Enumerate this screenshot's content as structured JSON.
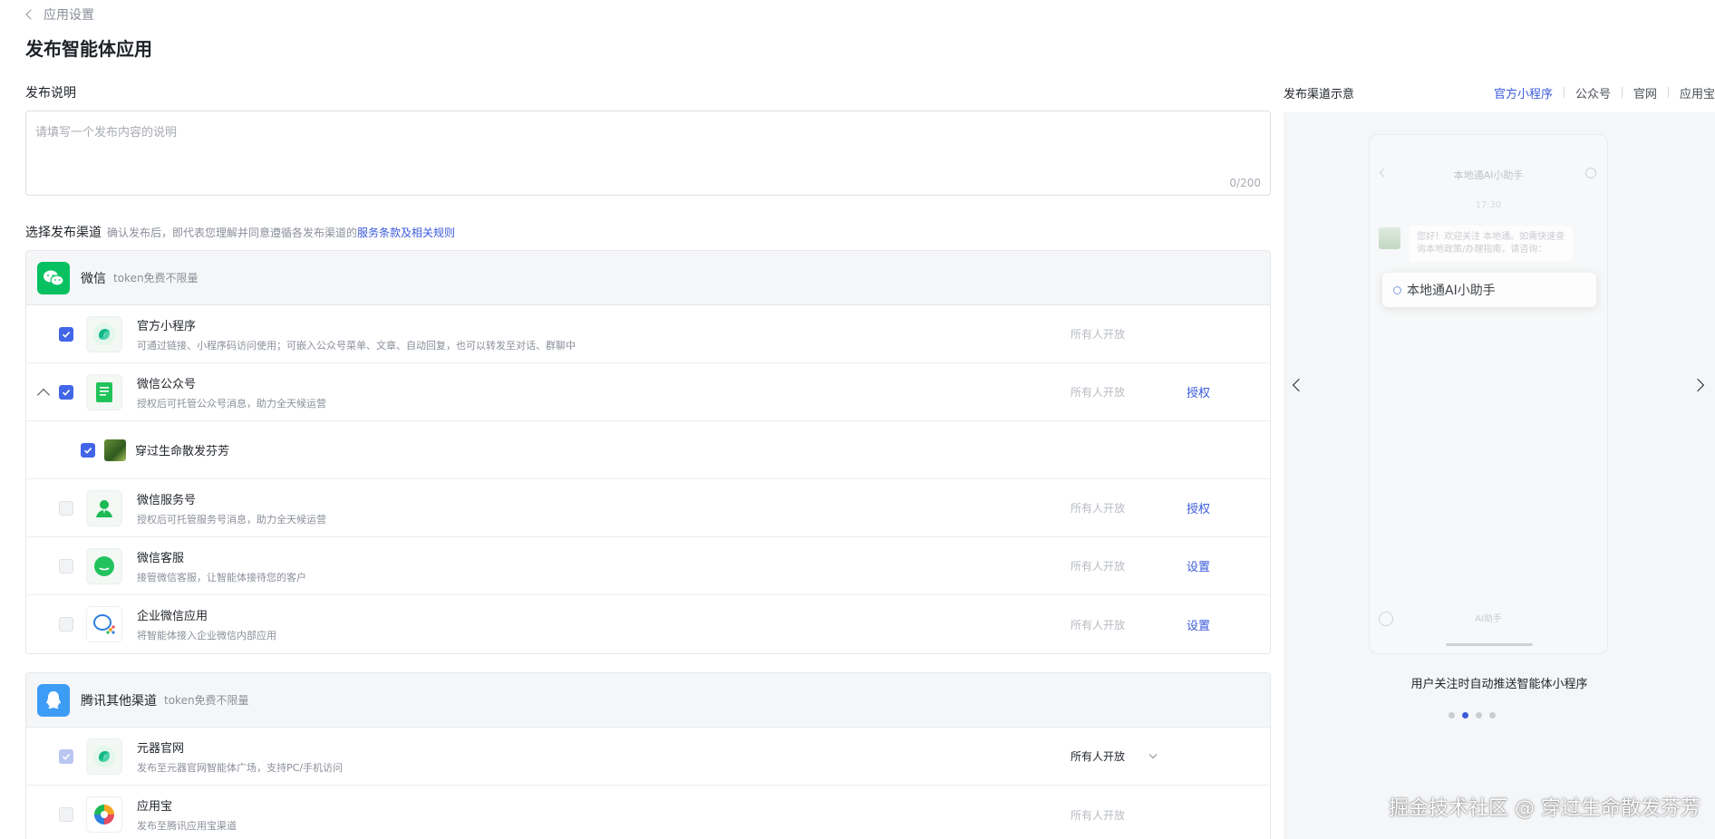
{
  "header": {
    "back_label": "应用设置",
    "title": "发布智能体应用"
  },
  "description": {
    "label": "发布说明",
    "placeholder": "请填写一个发布内容的说明",
    "value": "",
    "counter": "0/200"
  },
  "channels": {
    "label": "选择发布渠道",
    "hint": "确认发布后，即代表您理解并同意遵循各发布渠道的",
    "terms_link": "服务条款及相关规则",
    "groups": [
      {
        "title": "微信",
        "note": "token免费不限量",
        "icon": "wechat-icon",
        "items": [
          {
            "title": "官方小程序",
            "desc": "可通过链接、小程序码访问使用；可嵌入公众号菜单、文章、自动回复，也可以转发至对话、群聊中",
            "access": "所有人开放",
            "action": "",
            "checked": true
          },
          {
            "title": "微信公众号",
            "desc": "授权后可托管公众号消息，助力全天候运营",
            "access": "所有人开放",
            "action": "授权",
            "checked": true,
            "expanded": true,
            "sub": {
              "name": "穿过生命散发芬芳",
              "checked": true
            }
          },
          {
            "title": "微信服务号",
            "desc": "授权后可托管服务号消息，助力全天候运营",
            "access": "所有人开放",
            "action": "授权",
            "checked": false
          },
          {
            "title": "微信客服",
            "desc": "接管微信客服，让智能体接待您的客户",
            "access": "所有人开放",
            "action": "设置",
            "checked": false
          },
          {
            "title": "企业微信应用",
            "desc": "将智能体接入企业微信内部应用",
            "access": "所有人开放",
            "action": "设置",
            "checked": false
          }
        ]
      },
      {
        "title": "腾讯其他渠道",
        "note": "token免费不限量",
        "icon": "qq-icon",
        "items": [
          {
            "title": "元器官网",
            "desc": "发布至元器官网智能体广场，支持PC/手机访问",
            "access": "所有人开放",
            "checked": true
          },
          {
            "title": "应用宝",
            "desc": "发布至腾讯应用宝渠道",
            "access": "所有人开放",
            "checked": false
          }
        ]
      }
    ]
  },
  "preview": {
    "title": "发布渠道示意",
    "tabs": [
      "官方小程序",
      "公众号",
      "官网",
      "应用宝"
    ],
    "active_tab": 0,
    "phone": {
      "title": "本地通AI小助手",
      "time": "17:30",
      "message": "您好！欢迎关注 本地通。如需快速查询本地政策/办理指南，请咨询：",
      "card": "本地通AI小助手",
      "bottom_label": "AI助手"
    },
    "caption": "用户关注时自动推送智能体小程序",
    "dots": 4,
    "active_dot": 1
  },
  "watermark": "掘金技术社区 @ 穿过生命散发芬芳",
  "colors": {
    "accent": "#3b5bdb",
    "checkbox": "#4266e8",
    "wechat": "#07c160",
    "qq": "#3d9cf5"
  }
}
